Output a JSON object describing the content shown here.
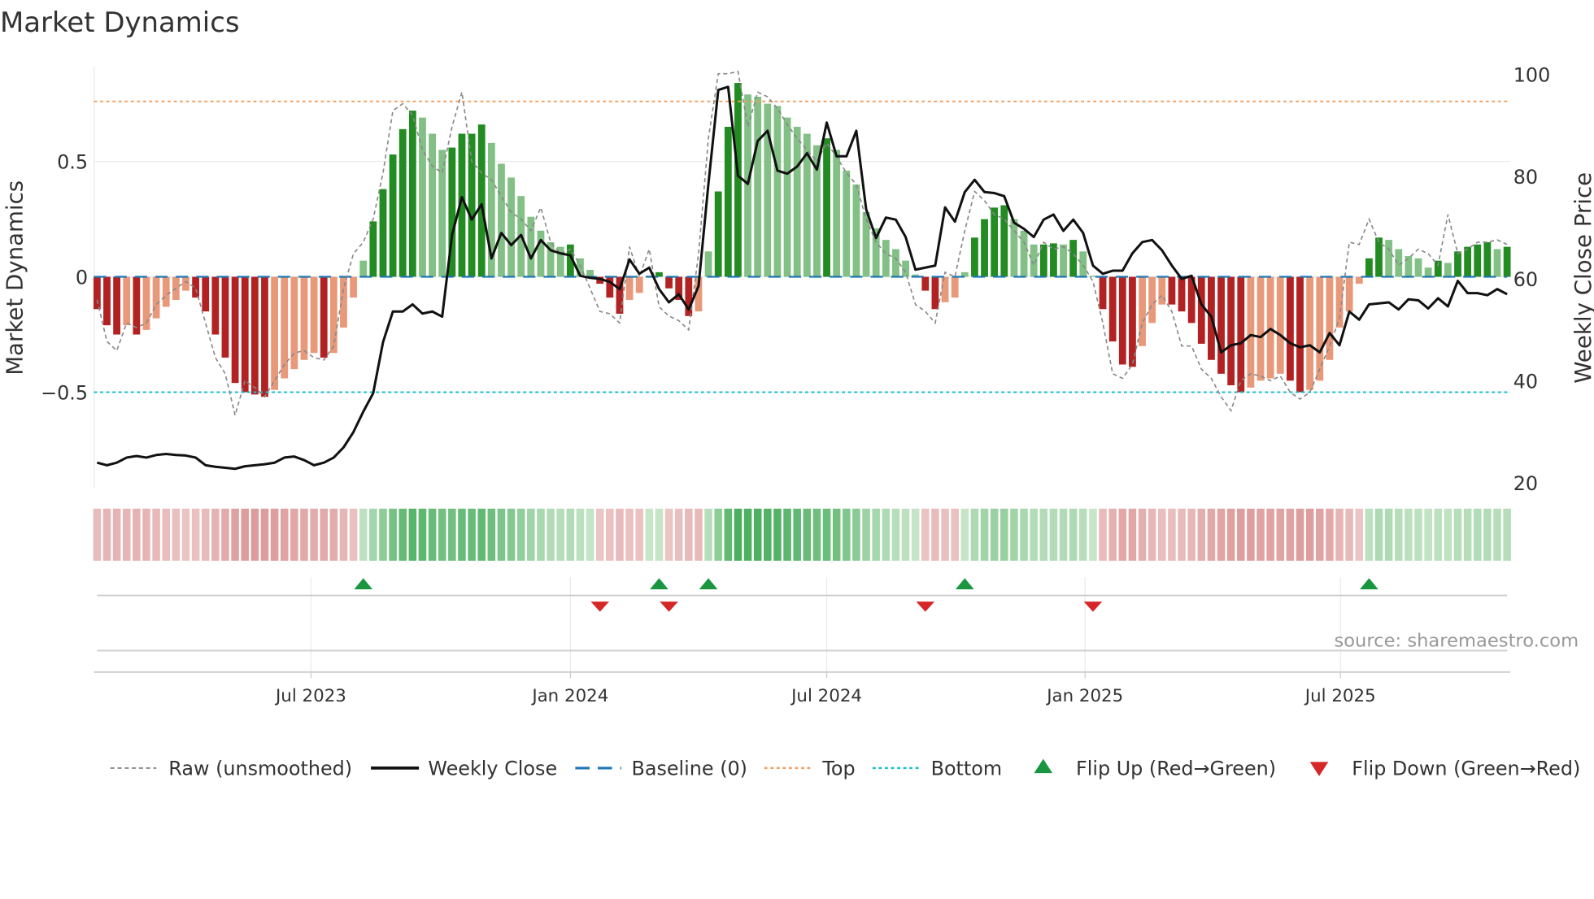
{
  "chart_data": {
    "type": "bar",
    "title": "Market Dynamics",
    "ylabel": "Market Dynamics",
    "y2label": "Weekly Close Price",
    "ylim": [
      -0.92,
      0.92
    ],
    "y2lim": [
      20,
      100
    ],
    "yticks": [
      {
        "v": 0.5,
        "label": "0.5"
      },
      {
        "v": 0,
        "label": "0"
      },
      {
        "v": -0.5,
        "label": "−0.5"
      }
    ],
    "y2ticks": [
      {
        "v": 100,
        "label": "100"
      },
      {
        "v": 80,
        "label": "80"
      },
      {
        "v": 60,
        "label": "60"
      },
      {
        "v": 40,
        "label": "40"
      },
      {
        "v": 20,
        "label": "20"
      }
    ],
    "top_level": 0.76,
    "bottom_level": -0.5,
    "xticks": [
      {
        "week": 21.7,
        "label": "Jul 2023"
      },
      {
        "week": 48.0,
        "label": "Jan 2024"
      },
      {
        "week": 74.0,
        "label": "Jul 2024"
      },
      {
        "week": 100.2,
        "label": "Jan 2025"
      },
      {
        "week": 126.1,
        "label": "Jul 2025"
      }
    ],
    "histogram": [
      -0.14,
      -0.21,
      -0.25,
      -0.21,
      -0.25,
      -0.23,
      -0.18,
      -0.13,
      -0.1,
      -0.06,
      -0.09,
      -0.15,
      -0.25,
      -0.35,
      -0.46,
      -0.5,
      -0.51,
      -0.52,
      -0.49,
      -0.44,
      -0.4,
      -0.36,
      -0.33,
      -0.35,
      -0.33,
      -0.22,
      -0.09,
      0.07,
      0.24,
      0.38,
      0.53,
      0.64,
      0.72,
      0.69,
      0.62,
      0.55,
      0.56,
      0.62,
      0.62,
      0.66,
      0.58,
      0.49,
      0.43,
      0.35,
      0.26,
      0.2,
      0.15,
      0.13,
      0.14,
      0.08,
      0.03,
      -0.03,
      -0.09,
      -0.16,
      -0.1,
      -0.07,
      0.005,
      0.02,
      -0.05,
      -0.1,
      -0.17,
      -0.15,
      0.11,
      0.37,
      0.65,
      0.84,
      0.79,
      0.78,
      0.75,
      0.74,
      0.69,
      0.65,
      0.62,
      0.57,
      0.6,
      0.55,
      0.46,
      0.4,
      0.28,
      0.21,
      0.16,
      0.12,
      0.07,
      0.01,
      -0.06,
      -0.14,
      -0.11,
      -0.09,
      0.02,
      0.17,
      0.25,
      0.3,
      0.31,
      0.25,
      0.2,
      0.14,
      0.14,
      0.145,
      0.14,
      0.16,
      0.11,
      0.005,
      -0.14,
      -0.28,
      -0.38,
      -0.39,
      -0.3,
      -0.2,
      -0.12,
      -0.12,
      -0.15,
      -0.2,
      -0.29,
      -0.36,
      -0.42,
      -0.47,
      -0.5,
      -0.48,
      -0.45,
      -0.44,
      -0.42,
      -0.45,
      -0.5,
      -0.49,
      -0.45,
      -0.36,
      -0.22,
      -0.15,
      -0.03,
      0.08,
      0.17,
      0.16,
      0.12,
      0.09,
      0.08,
      0.04,
      0.07,
      0.06,
      0.11,
      0.13,
      0.14,
      0.15,
      0.12,
      0.13
    ],
    "raw": [
      -0.1,
      -0.28,
      -0.32,
      -0.2,
      -0.22,
      -0.2,
      -0.12,
      -0.08,
      -0.05,
      -0.02,
      -0.05,
      -0.2,
      -0.35,
      -0.42,
      -0.6,
      -0.45,
      -0.48,
      -0.52,
      -0.45,
      -0.38,
      -0.33,
      -0.32,
      -0.35,
      -0.36,
      -0.3,
      -0.05,
      0.1,
      0.15,
      0.25,
      0.45,
      0.72,
      0.75,
      0.7,
      0.55,
      0.48,
      0.45,
      0.65,
      0.8,
      0.5,
      0.45,
      0.42,
      0.35,
      0.28,
      0.25,
      0.2,
      0.3,
      0.15,
      0.1,
      0.12,
      0.05,
      -0.05,
      -0.15,
      -0.16,
      -0.2,
      0.13,
      0.0,
      0.12,
      -0.13,
      -0.17,
      -0.19,
      -0.23,
      0.1,
      0.6,
      0.88,
      0.88,
      0.89,
      0.65,
      0.8,
      0.78,
      0.73,
      0.66,
      0.6,
      0.55,
      0.5,
      0.58,
      0.52,
      0.45,
      0.4,
      0.25,
      0.15,
      0.1,
      0.08,
      0.02,
      -0.12,
      -0.15,
      -0.2,
      0.02,
      0.0,
      0.2,
      0.37,
      0.33,
      0.27,
      0.25,
      0.2,
      0.15,
      0.05,
      0.15,
      0.12,
      0.13,
      0.1,
      0.05,
      -0.02,
      -0.2,
      -0.42,
      -0.44,
      -0.38,
      -0.2,
      -0.12,
      -0.08,
      -0.15,
      -0.3,
      -0.3,
      -0.4,
      -0.44,
      -0.52,
      -0.58,
      -0.45,
      -0.42,
      -0.43,
      -0.45,
      -0.43,
      -0.5,
      -0.53,
      -0.5,
      -0.4,
      -0.3,
      -0.18,
      0.15,
      0.14,
      0.25,
      0.15,
      0.12,
      0.05,
      0.08,
      0.12,
      0.1,
      0.05,
      0.27,
      0.1,
      0.12,
      0.15,
      0.15,
      0.16,
      0.14,
      0.15
    ],
    "close": [
      24,
      23.5,
      24,
      25,
      25.3,
      25,
      25.5,
      25.7,
      25.5,
      25.4,
      25,
      23.5,
      23.2,
      23,
      22.8,
      23.3,
      23.5,
      23.7,
      24,
      25,
      25.2,
      24.5,
      23.5,
      24,
      25,
      27,
      30,
      34,
      37.6,
      47.6,
      53.6,
      53.6,
      55,
      53.2,
      53.6,
      52.6,
      68.6,
      76,
      71.6,
      74.6,
      64,
      69,
      66.6,
      68.6,
      64,
      67.6,
      65.6,
      65,
      64.6,
      60.6,
      60.2,
      60,
      59.4,
      58,
      63.8,
      61,
      62.2,
      58,
      55.4,
      57,
      54,
      58.6,
      78.6,
      97,
      97.6,
      80.2,
      78.6,
      87,
      89,
      81.2,
      80.6,
      82,
      84.6,
      81.4,
      90.6,
      84,
      84,
      89,
      73.6,
      68,
      72,
      71.6,
      68.2,
      61.8,
      62.2,
      62.6,
      74,
      71.2,
      77,
      79.4,
      77,
      76.8,
      76.2,
      71,
      69.8,
      68.2,
      71.6,
      72.6,
      69.4,
      71.6,
      69,
      62.6,
      61,
      61.6,
      61.6,
      65,
      67.2,
      67.6,
      65.6,
      62.6,
      60,
      60.6,
      55,
      52.6,
      45.6,
      47,
      47.4,
      49,
      48.6,
      50.2,
      49,
      47.4,
      46.6,
      47,
      45.6,
      49.4,
      47,
      53.6,
      52,
      55,
      55.2,
      55.4,
      54,
      56,
      55.8,
      54.2,
      56.2,
      54.6,
      59.6,
      57.2,
      57.2,
      56.8,
      58,
      57
    ],
    "flip_up_weeks": [
      27,
      57,
      62,
      88,
      129
    ],
    "flip_down_weeks": [
      51,
      58,
      84,
      101
    ],
    "legend": [
      "Raw (unsmoothed)",
      "Weekly Close",
      "Baseline (0)",
      "Top",
      "Bottom",
      "Flip Up (Red→Green)",
      "Flip Down (Green→Red)"
    ],
    "source": "source: sharemaestro.com",
    "colors": {
      "green_strong": "#228b22",
      "green_weak": "#82c085",
      "red_strong": "#b22222",
      "red_weak": "#e8997a",
      "top": "#f0a060",
      "bottom": "#17becf",
      "baseline": "#1f77b4",
      "flip_up": "#1a9641",
      "flip_down": "#d62728"
    }
  }
}
